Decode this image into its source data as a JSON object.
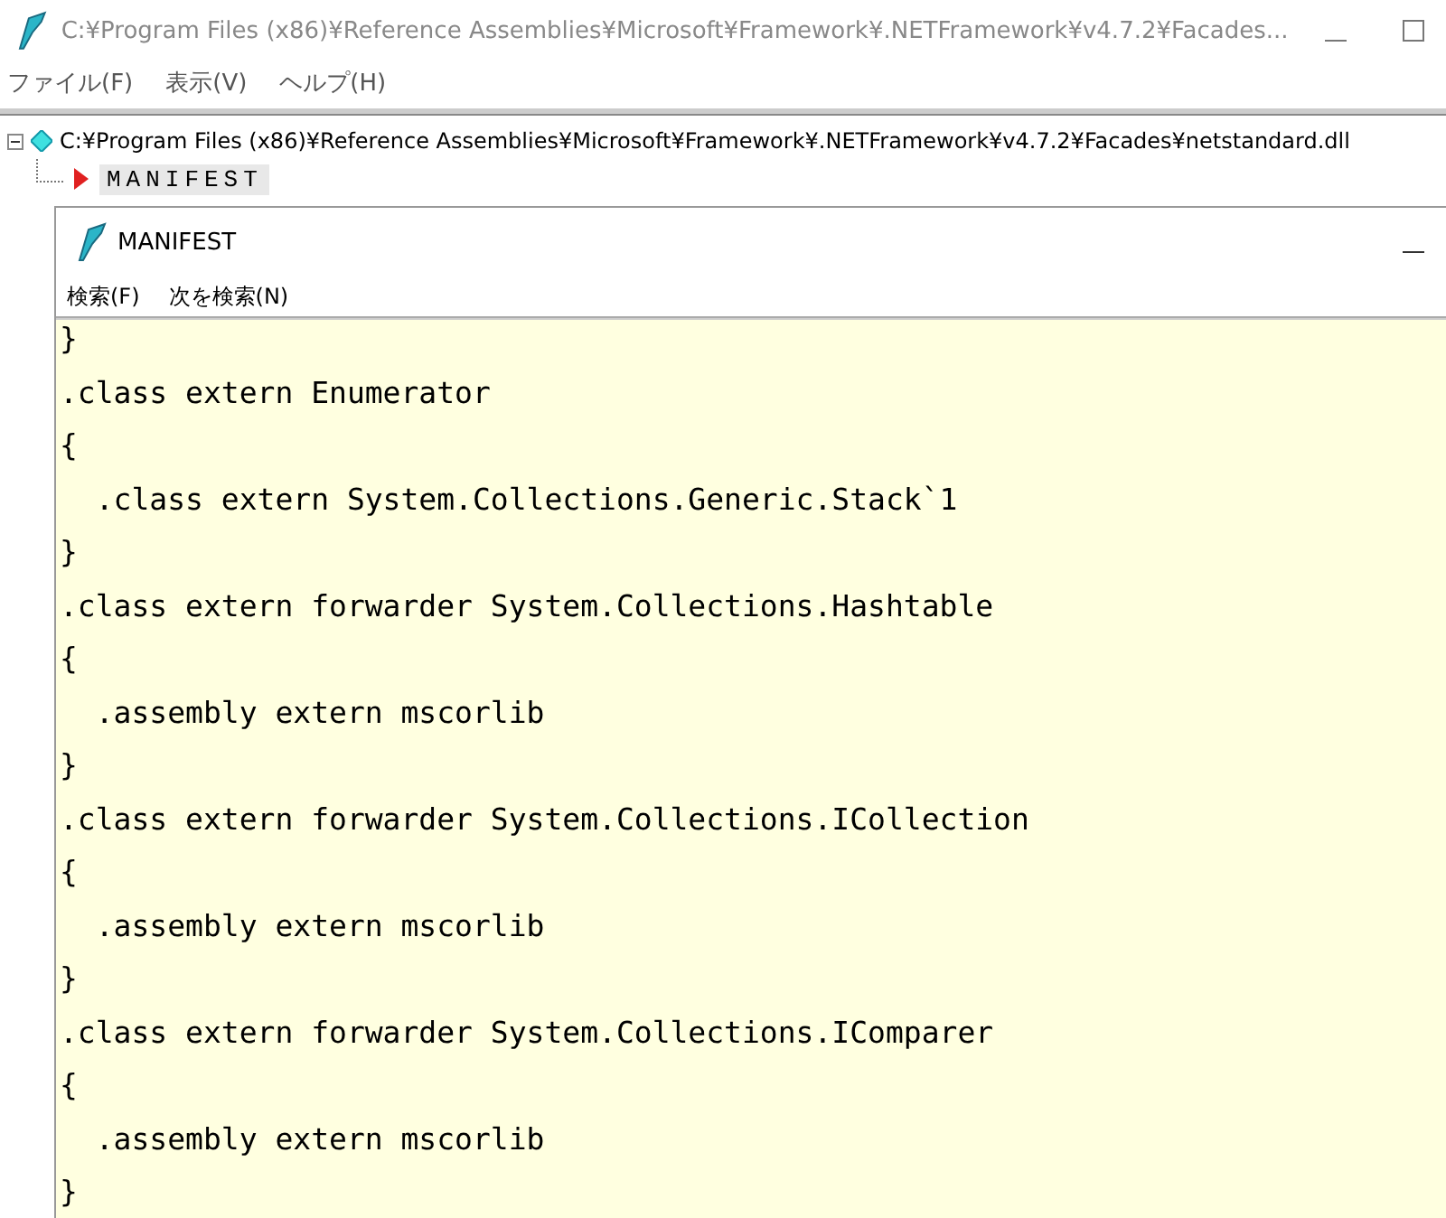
{
  "window": {
    "title": "C:¥Program Files (x86)¥Reference Assemblies¥Microsoft¥Framework¥.NETFramework¥v4.7.2¥Facades..."
  },
  "menu": [
    "ファイル(F)",
    "表示(V)",
    "ヘルプ(H)"
  ],
  "tree": {
    "label": "C:¥Program Files (x86)¥Reference Assemblies¥Microsoft¥Framework¥.NETFramework¥v4.7.2¥Facades¥netstandard.dll",
    "expanded": true,
    "children": [
      {
        "label": "MANIFEST",
        "selected": true
      }
    ]
  },
  "child_window": {
    "title": "MANIFEST",
    "menu": [
      "検索(F)",
      "次を検索(N)"
    ],
    "lines": [
      "}",
      ".class extern Enumerator",
      "{",
      "  .class extern System.Collections.Generic.Stack`1",
      "}",
      ".class extern forwarder System.Collections.Hashtable",
      "{",
      "  .assembly extern mscorlib",
      "}",
      ".class extern forwarder System.Collections.ICollection",
      "{",
      "  .assembly extern mscorlib",
      "}",
      ".class extern forwarder System.Collections.IComparer",
      "{",
      "  .assembly extern mscorlib",
      "}"
    ]
  }
}
